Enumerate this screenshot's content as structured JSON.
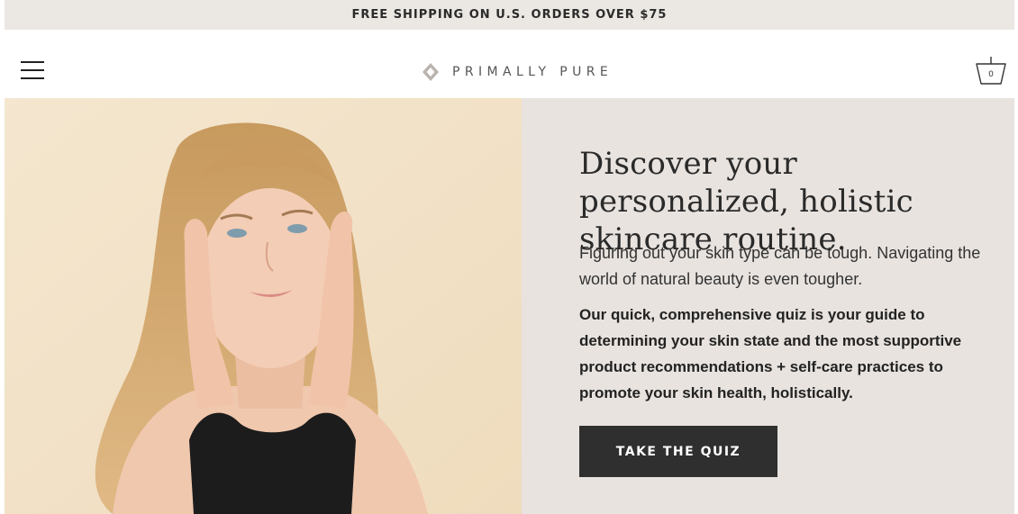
{
  "promo_banner": {
    "text": "FREE SHIPPING ON U.S. ORDERS OVER $75"
  },
  "header": {
    "menu_icon": "hamburger-menu-icon",
    "logo_icon": "diamond-logo-icon",
    "brand": "PRIMALLY PURE",
    "cart_icon": "basket-cart-icon",
    "cart_count": "0"
  },
  "hero": {
    "image_alt": "woman-touching-face-photo",
    "headline": "Discover your personalized, holistic skincare routine.",
    "intro": "Figuring out your skin type can be tough. Navigating the world of natural beauty is even tougher.",
    "quiz_description": "Our quick, comprehensive quiz is your guide to determining your skin state and the most supportive product recommendations + self-care practices to promote your skin health, holistically.",
    "cta_label": "TAKE THE QUIZ"
  },
  "colors": {
    "promo_bg": "#ebe7e3",
    "panel_bg": "#e8e3df",
    "photo_bg": "#f2e2c8",
    "cta_bg": "#2f2f2f",
    "cta_text": "#ffffff"
  }
}
